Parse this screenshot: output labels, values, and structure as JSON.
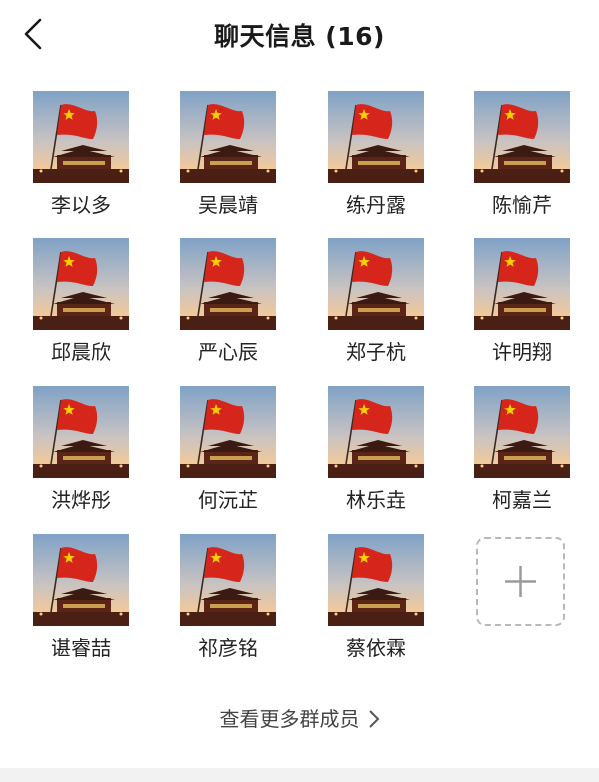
{
  "header": {
    "title": "聊天信息 (16)"
  },
  "members": [
    {
      "name": "李以多"
    },
    {
      "name": "吴晨靖"
    },
    {
      "name": "练丹露"
    },
    {
      "name": "陈愉芹"
    },
    {
      "name": "邱晨欣"
    },
    {
      "name": "严心辰"
    },
    {
      "name": "郑子杭"
    },
    {
      "name": "许明翔"
    },
    {
      "name": "洪烨彤"
    },
    {
      "name": "何沅芷"
    },
    {
      "name": "林乐垚"
    },
    {
      "name": "柯嘉兰"
    },
    {
      "name": "谌睿喆"
    },
    {
      "name": "祁彦铭"
    },
    {
      "name": "蔡依霖"
    }
  ],
  "footer": {
    "view_more_label": "查看更多群成员"
  },
  "icons": {
    "back": "back-chevron-icon",
    "add": "plus-icon",
    "more": "chevron-right-icon"
  },
  "colors": {
    "flag": "#d6261c",
    "star": "#f5d000",
    "sky_top": "#7fa2c6",
    "sky_bottom": "#f2c99a",
    "building": "#4a1f14"
  }
}
